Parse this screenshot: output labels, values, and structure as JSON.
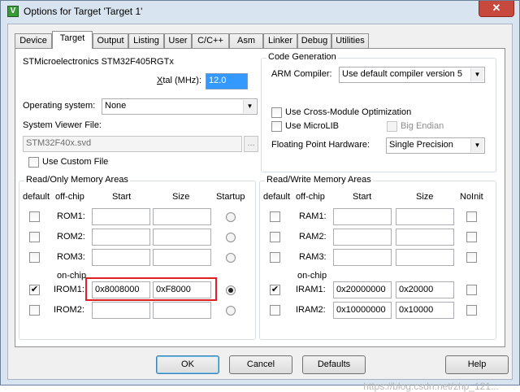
{
  "window": {
    "title": "Options for Target 'Target 1'",
    "close_glyph": "✕",
    "icon": "V"
  },
  "tabs": [
    "Device",
    "Target",
    "Output",
    "Listing",
    "User",
    "C/C++",
    "Asm",
    "Linker",
    "Debug",
    "Utilities"
  ],
  "device": {
    "name": "STMicroelectronics STM32F405RGTx"
  },
  "xtal": {
    "label_pre": "X",
    "label_post": "tal (MHz):",
    "value": "12.0"
  },
  "os": {
    "label": "Operating system:",
    "value": "None"
  },
  "svd": {
    "label": "System Viewer File:",
    "value": "STM32F40x.svd",
    "browse": "..."
  },
  "custom_file": {
    "label": "Use Custom File"
  },
  "codegen": {
    "title": "Code Generation",
    "compiler_label": "ARM Compiler:",
    "compiler_value": "Use default compiler version 5",
    "cross_module": "Use Cross-Module Optimization",
    "microlib": "Use MicroLIB",
    "big_endian": "Big Endian",
    "fp_label": "Floating Point Hardware:",
    "fp_value": "Single Precision"
  },
  "ro": {
    "title": "Read/Only Memory Areas",
    "headers": {
      "default": "default",
      "offchip": "off-chip",
      "start": "Start",
      "size": "Size",
      "startup": "Startup"
    },
    "onchip": "on-chip",
    "rows": [
      {
        "name": "ROM1:",
        "start": "",
        "size": "",
        "default": false,
        "startup": false
      },
      {
        "name": "ROM2:",
        "start": "",
        "size": "",
        "default": false,
        "startup": false
      },
      {
        "name": "ROM3:",
        "start": "",
        "size": "",
        "default": false,
        "startup": false
      },
      {
        "name": "IROM1:",
        "start": "0x8008000",
        "size": "0xF8000",
        "default": true,
        "startup": true
      },
      {
        "name": "IROM2:",
        "start": "",
        "size": "",
        "default": false,
        "startup": false
      }
    ]
  },
  "rw": {
    "title": "Read/Write Memory Areas",
    "headers": {
      "default": "default",
      "offchip": "off-chip",
      "start": "Start",
      "size": "Size",
      "noinit": "NoInit"
    },
    "onchip": "on-chip",
    "rows": [
      {
        "name": "RAM1:",
        "start": "",
        "size": "",
        "default": false
      },
      {
        "name": "RAM2:",
        "start": "",
        "size": "",
        "default": false
      },
      {
        "name": "RAM3:",
        "start": "",
        "size": "",
        "default": false
      },
      {
        "name": "IRAM1:",
        "start": "0x20000000",
        "size": "0x20000",
        "default": true
      },
      {
        "name": "IRAM2:",
        "start": "0x10000000",
        "size": "0x10000",
        "default": false
      }
    ]
  },
  "buttons": {
    "ok": "OK",
    "cancel": "Cancel",
    "defaults": "Defaults",
    "help": "Help"
  },
  "watermark": "https://blog.csdn.net/zhp_121..."
}
